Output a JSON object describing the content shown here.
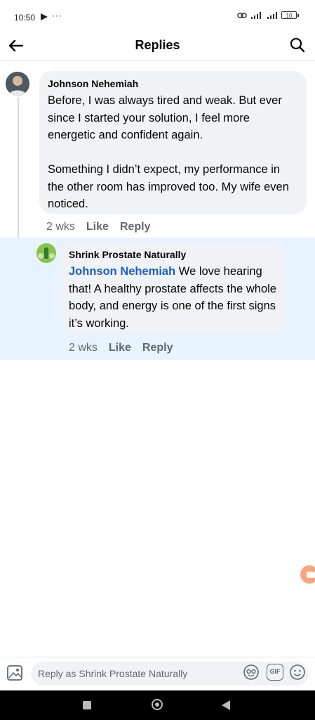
{
  "status_bar": {
    "time": "10:50",
    "more": "···",
    "battery": "10"
  },
  "header": {
    "title": "Replies"
  },
  "parent_comment": {
    "author": "Johnson Nehemiah",
    "text": "Before, I was always tired and weak. But ever since I started your solution, I feel more energetic and confident again.\n\nSomething I didn’t expect, my performance in the other room has improved too. My wife even noticed.",
    "time": "2 wks",
    "like_label": "Like",
    "reply_label": "Reply"
  },
  "reply_comment": {
    "author": "Shrink Prostate Naturally",
    "mention": "Johnson Nehemiah",
    "text": " We love hearing that! A healthy prostate affects the whole body, and energy is one of the first signs it’s working.",
    "time": "2 wks",
    "like_label": "Like",
    "reply_label": "Reply"
  },
  "composer": {
    "placeholder": "Reply as Shrink Prostate Naturally",
    "gif_label": "GIF"
  },
  "colors": {
    "highlight": "#e7f3ff",
    "mention": "#1b5fc7",
    "secondary_text": "#65676b"
  }
}
